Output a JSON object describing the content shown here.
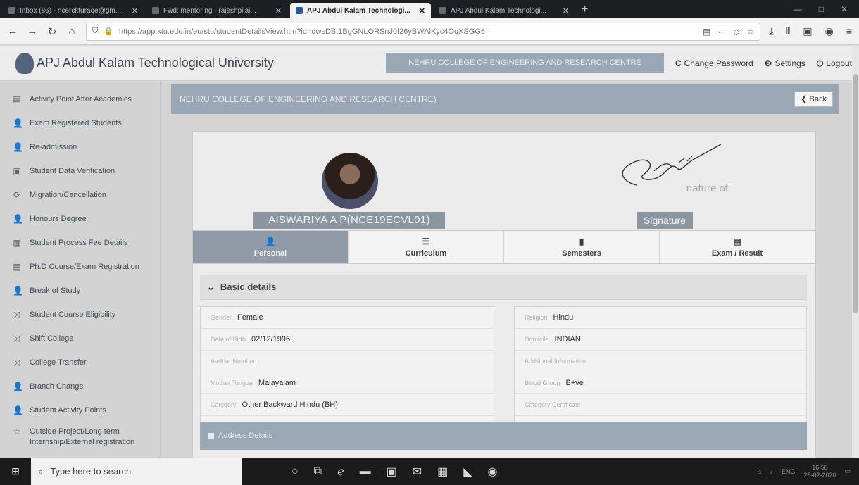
{
  "browser": {
    "tabs": [
      {
        "label": "Inbox (86) - ncerckturaqe@gm...",
        "active": false
      },
      {
        "label": "Fwd: mentor ng - rajeshpilai...",
        "active": false
      },
      {
        "label": "APJ Abdul Kalam Technologi...",
        "active": true
      },
      {
        "label": "APJ Abdul Kalam Technologi...",
        "active": false
      }
    ],
    "url": "https://app.ktu.edu.in/eu/stu/studentDetailsView.htm?id=dwsDBt1BgGNLORSnJ0f26yBWAlKyc4OqXSGG6"
  },
  "app": {
    "title": "APJ Abdul Kalam Technological University",
    "college": "NEHRU COLLEGE OF ENGINEERING AND RESEARCH CENTRE",
    "actions": {
      "change_password": "Change Password",
      "settings": "Settings",
      "logout": "Logout"
    }
  },
  "sidebar": {
    "items": [
      {
        "label": "Activity Point After Academics",
        "icon": "table-icon"
      },
      {
        "label": "Exam Registered Students",
        "icon": "user-icon"
      },
      {
        "label": "Re-admission",
        "icon": "user-icon"
      },
      {
        "label": "Student Data Verification",
        "icon": "id-card-icon"
      },
      {
        "label": "Migration/Cancellation",
        "icon": "cycle-icon"
      },
      {
        "label": "Honours Degree",
        "icon": "user-icon"
      },
      {
        "label": "Student Process Fee Details",
        "icon": "receipt-icon"
      },
      {
        "label": "Ph.D Course/Exam Registration",
        "icon": "table-icon"
      },
      {
        "label": "Break of Study",
        "icon": "user-icon"
      },
      {
        "label": "Student Course Eligibility",
        "icon": "shuffle-icon"
      },
      {
        "label": "Shift College",
        "icon": "shuffle-icon"
      },
      {
        "label": "College Transfer",
        "icon": "shuffle-icon"
      },
      {
        "label": "Branch Change",
        "icon": "user-icon"
      },
      {
        "label": "Student Activity Points",
        "icon": "user-icon"
      },
      {
        "label": "Outside Project/Long term Internship/External registration",
        "icon": "star-icon"
      }
    ]
  },
  "main": {
    "title": "NEHRU COLLEGE OF ENGINEERING AND RESEARCH CENTRE)",
    "back": "Back",
    "student_name": "AISWARIYA A P(NCE19ECVL01)",
    "signature_badge": "Signature",
    "signature_faint": "nature of",
    "tabs": [
      {
        "label": "Personal",
        "active": true
      },
      {
        "label": "Curriculum",
        "active": false
      },
      {
        "label": "Semesters",
        "active": false
      },
      {
        "label": "Exam / Result",
        "active": false
      }
    ],
    "section": "Basic details",
    "left": [
      {
        "label": "Gender",
        "value": "Female"
      },
      {
        "label": "Date of Birth",
        "value": "02/12/1996"
      },
      {
        "label": "Aadhar Number",
        "value": ""
      },
      {
        "label": "Mother Tongue",
        "value": "Malayalam"
      },
      {
        "label": "Category",
        "value": "Other Backward Hindu (BH)"
      }
    ],
    "right": [
      {
        "label": "Religion",
        "value": "Hindu"
      },
      {
        "label": "Domicile",
        "value": "INDIAN"
      },
      {
        "label": "Additional Information",
        "value": ""
      },
      {
        "label": "Blood Group",
        "value": "B+ve"
      },
      {
        "label": "Category Certificate",
        "value": ""
      }
    ],
    "address": "Address Details"
  },
  "taskbar": {
    "search_placeholder": "Type here to search",
    "lang": "ENG",
    "time": "16:58",
    "date": "25-02-2020"
  }
}
